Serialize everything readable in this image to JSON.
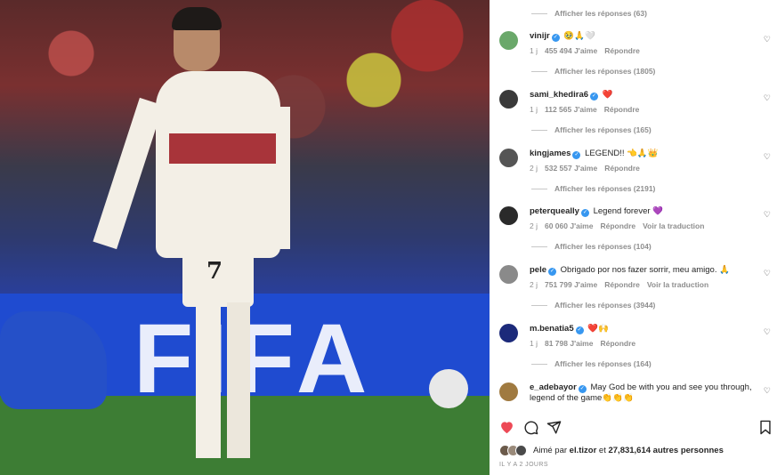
{
  "photo": {
    "alt_jersey_number": "7",
    "board_text": "FIFA"
  },
  "replies": [
    "Afficher les réponses (63)",
    "Afficher les réponses (1805)",
    "Afficher les réponses (165)",
    "Afficher les réponses (2191)",
    "Afficher les réponses (104)",
    "Afficher les réponses (3944)",
    "Afficher les réponses (164)"
  ],
  "comments": [
    {
      "user": "vinijr",
      "text": "🥹🙏🤍",
      "time": "1 j",
      "likes": "455 494 J'aime",
      "reply": "Répondre",
      "translate": "",
      "avatar_color": "#6aa86a"
    },
    {
      "user": "sami_khedira6",
      "text": "❤️",
      "time": "1 j",
      "likes": "112 565 J'aime",
      "reply": "Répondre",
      "translate": "",
      "avatar_color": "#3a3a3a"
    },
    {
      "user": "kingjames",
      "text": "LEGEND!! 👈🙏👑",
      "time": "2 j",
      "likes": "532 557 J'aime",
      "reply": "Répondre",
      "translate": "",
      "avatar_color": "#555555"
    },
    {
      "user": "peterqueally",
      "text": "Legend forever 💜",
      "time": "2 j",
      "likes": "60 060 J'aime",
      "reply": "Répondre",
      "translate": "Voir la traduction",
      "avatar_color": "#2a2a2a"
    },
    {
      "user": "pele",
      "text": "Obrigado por nos fazer sorrir, meu amigo. 🙏",
      "time": "2 j",
      "likes": "751 799 J'aime",
      "reply": "Répondre",
      "translate": "Voir la traduction",
      "avatar_color": "#8a8a8a"
    },
    {
      "user": "m.benatia5",
      "text": "❤️🙌",
      "time": "1 j",
      "likes": "81 798 J'aime",
      "reply": "Répondre",
      "translate": "",
      "avatar_color": "#1c2a7a"
    },
    {
      "user": "e_adebayor",
      "text": "May God be with you and see you through, legend of the game👏👏👏",
      "time": "",
      "likes": "",
      "reply": "",
      "translate": "",
      "avatar_color": "#a07a40"
    }
  ],
  "footer": {
    "liked_by_prefix": "Aimé par ",
    "liked_by_user": "el.tizor",
    "liked_by_mid": " et ",
    "liked_by_count": "27,831,614 autres personnes",
    "timestamp": "IL Y A 2 JOURS",
    "icons": [
      "heart-filled-icon",
      "comment-icon",
      "share-icon",
      "bookmark-icon"
    ],
    "heart_color": "#ed4956"
  }
}
